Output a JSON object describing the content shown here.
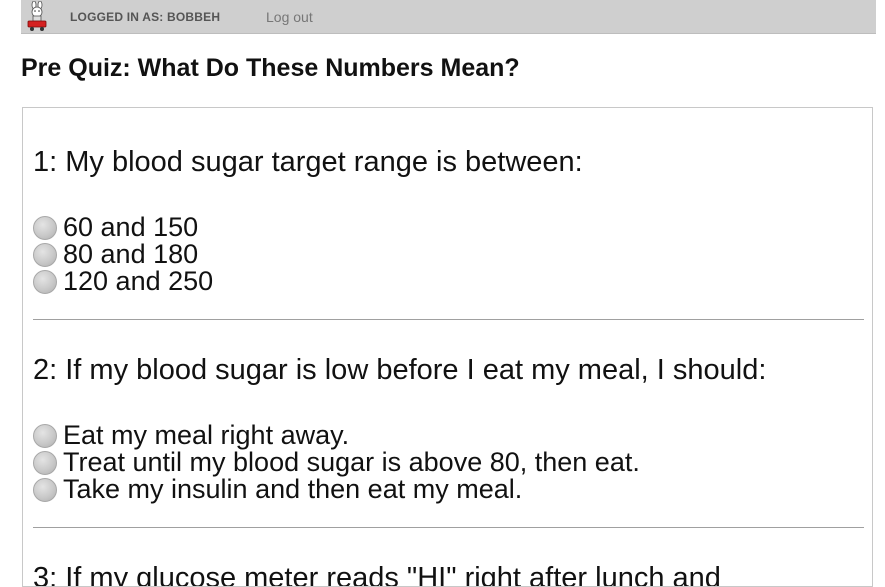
{
  "header": {
    "logged_in_text": "LOGGED IN AS: BOBBEH",
    "logout_label": "Log out"
  },
  "page": {
    "title": "Pre Quiz: What Do These Numbers Mean?"
  },
  "quiz": {
    "questions": [
      {
        "text": "1: My blood sugar target range is between:",
        "options": [
          "60 and 150",
          "80 and 180",
          "120 and 250"
        ]
      },
      {
        "text": "2: If my blood sugar is low before I eat my meal, I should:",
        "options": [
          "Eat my meal right away.",
          "Treat until my blood sugar is above 80, then eat.",
          "Take my insulin and then eat my meal."
        ]
      },
      {
        "text": "3: If my glucose meter reads \"HI\" right after lunch and"
      }
    ]
  }
}
